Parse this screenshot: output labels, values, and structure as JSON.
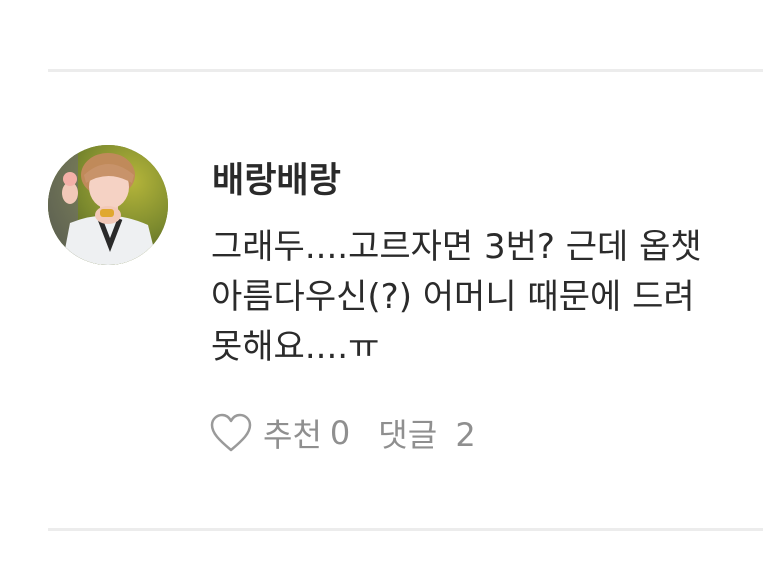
{
  "comment": {
    "author": "배랑배랑",
    "avatar_icon": "user-avatar-photo",
    "body_lines": [
      "그래두....고르자면 3번? 근데 옵챗",
      "아름다우신(?) 어머니 때문에 드려",
      "못해요....ㅠ"
    ],
    "actions": {
      "like_icon": "heart-outline-icon",
      "like_label": "추천",
      "like_count": "0",
      "reply_label": "댓글",
      "reply_count": "2"
    }
  },
  "colors": {
    "divider": "#ececec",
    "author_text": "#2a2a2a",
    "body_text": "#2b2b2b",
    "action_text": "#8f8f8f"
  }
}
